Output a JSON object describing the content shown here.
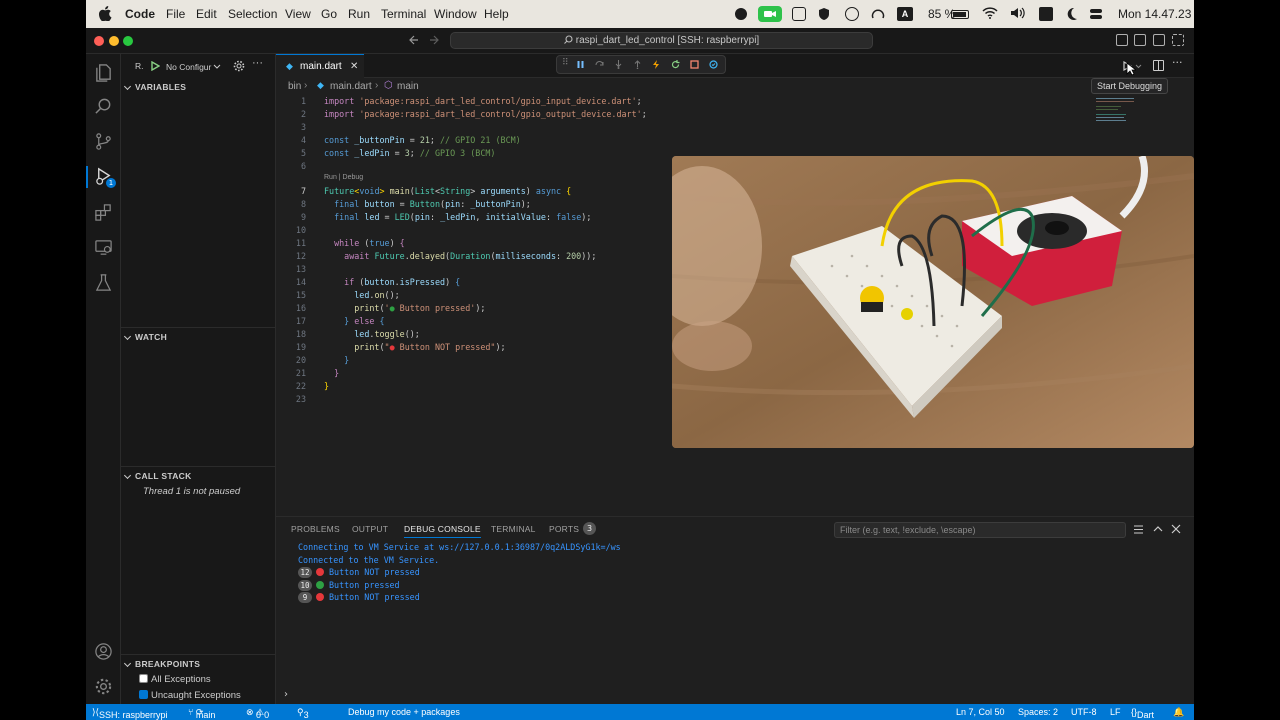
{
  "menubar": {
    "app": "Code",
    "items": [
      "File",
      "Edit",
      "Selection",
      "View",
      "Go",
      "Run",
      "Terminal",
      "Window",
      "Help"
    ],
    "battery": "85 %",
    "clock": "Mon 14.47.23"
  },
  "titlebar": {
    "command_center": "raspi_dart_led_control [SSH: raspberrypi]"
  },
  "sidebar": {
    "run_label": "R.",
    "config": "No Configur",
    "sections": {
      "variables": "VARIABLES",
      "watch": "WATCH",
      "call_stack": "CALL STACK",
      "call_stack_item": "Thread 1 is not paused",
      "breakpoints": "BREAKPOINTS"
    },
    "breakpoints": [
      {
        "label": "All Exceptions",
        "checked": false
      },
      {
        "label": "Uncaught Exceptions",
        "checked": true
      }
    ]
  },
  "editor": {
    "tab": "main.dart",
    "breadcrumb": {
      "folder": "bin",
      "file": "main.dart",
      "symbol": "main"
    },
    "codelens": "Run | Debug",
    "current_line": 7,
    "line_numbers": [
      "1",
      "2",
      "3",
      "4",
      "5",
      "6",
      "7",
      "8",
      "9",
      "10",
      "11",
      "12",
      "13",
      "14",
      "15",
      "16",
      "17",
      "18",
      "19",
      "20",
      "21",
      "22",
      "23"
    ]
  },
  "tooltip": "Start Debugging",
  "panel": {
    "tabs": [
      "PROBLEMS",
      "OUTPUT",
      "DEBUG CONSOLE",
      "TERMINAL",
      "PORTS"
    ],
    "ports_count": "3",
    "filter_placeholder": "Filter (e.g. text, !exclude, \\escape)",
    "console": [
      {
        "text": "Connecting to VM Service at ws://127.0.0.1:36987/0q2ALDSyG1k=/ws"
      },
      {
        "text": "Connected to the VM Service."
      },
      {
        "count": "12",
        "dot": "red",
        "text": "Button NOT pressed"
      },
      {
        "count": "10",
        "dot": "green",
        "text": "Button pressed"
      },
      {
        "count": "9",
        "dot": "red",
        "text": "Button NOT pressed"
      }
    ]
  },
  "statusbar": {
    "remote": "SSH: raspberrypi",
    "branch": "main",
    "errors": "0",
    "warnings": "0",
    "workers": "3",
    "debug_mode": "Debug my code + packages",
    "position": "Ln 7, Col 50",
    "spaces": "Spaces: 2",
    "encoding": "UTF-8",
    "eol": "LF",
    "language": "Dart"
  },
  "colors": {
    "accent": "#0078d4",
    "debug_badge": "#0078d4",
    "green_dot": "#2ea043",
    "red_dot": "#e5383b"
  }
}
